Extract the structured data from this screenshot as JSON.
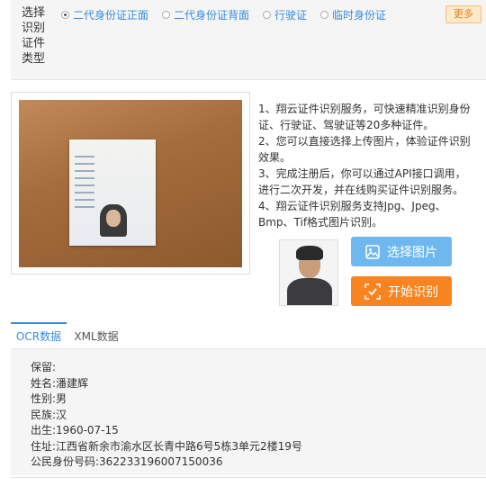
{
  "type_selector": {
    "label": "选择识别证件类型",
    "options": [
      {
        "label": "二代身份证正面",
        "checked": true
      },
      {
        "label": "二代身份证背面",
        "checked": false
      },
      {
        "label": "行驶证",
        "checked": false
      },
      {
        "label": "临时身份证",
        "checked": false
      }
    ],
    "more_label": "更多"
  },
  "description": [
    "1、翔云证件识别服务，可快速精准识别身份证、行驶证、驾驶证等20多种证件。",
    "2、您可以直接选择上传图片，体验证件识别效果。",
    "3、完成注册后，你可以通过API接口调用，进行二次开发，并在线购买证件识别服务。",
    "4、翔云证件识别服务支持Jpg、Jpeg、Bmp、Tif格式图片识别。"
  ],
  "buttons": {
    "select_label": "选择图片",
    "start_label": "开始识别"
  },
  "tabs": [
    {
      "label": "OCR数据",
      "active": true
    },
    {
      "label": "XML数据",
      "active": false
    }
  ],
  "result": [
    "保留:",
    "姓名:潘建辉",
    "性别:男",
    "民族:汉",
    "出生:1960-07-15",
    "住址:江西省新余市渝水区长青中路6号5栋3单元2楼19号",
    "公民身份号码:362233196007150036"
  ],
  "icons": {
    "select": "image-upload-icon",
    "start": "scan-icon"
  },
  "colors": {
    "accent_blue": "#3a8bdf",
    "select_button": "#6fb8ef",
    "start_button": "#f7841f",
    "more_bg": "#ffe9c6"
  }
}
